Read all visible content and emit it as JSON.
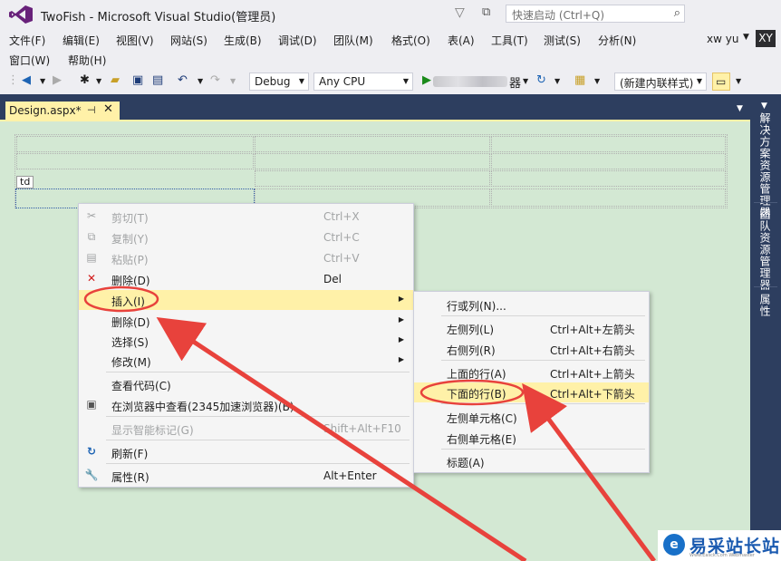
{
  "window": {
    "title": "TwoFish - Microsoft Visual Studio(管理员)",
    "quick_launch_placeholder": "快速启动 (Ctrl+Q)"
  },
  "menubar": {
    "row1": [
      "文件(F)",
      "编辑(E)",
      "视图(V)",
      "网站(S)",
      "生成(B)",
      "调试(D)",
      "团队(M)",
      "格式(O)",
      "表(A)",
      "工具(T)",
      "测试(S)",
      "分析(N)"
    ],
    "row2": [
      "窗口(W)",
      "帮助(H)"
    ],
    "user_name": "xw yu",
    "user_initials": "XY"
  },
  "toolbar": {
    "config": "Debug",
    "platform": "Any CPU",
    "start_suffix": "器",
    "style_target": "(新建内联样式)"
  },
  "document": {
    "tab_label": "Design.aspx*",
    "selected_tag": "td"
  },
  "side_panels": [
    "解决方案资源管理器",
    "团队资源管理器",
    "属性"
  ],
  "context_menu": {
    "items": [
      {
        "label": "剪切(T)",
        "shortcut": "Ctrl+X",
        "icon": "cut-icon",
        "disabled": true
      },
      {
        "label": "复制(Y)",
        "shortcut": "Ctrl+C",
        "icon": "copy-icon",
        "disabled": true
      },
      {
        "label": "粘贴(P)",
        "shortcut": "Ctrl+V",
        "icon": "paste-icon",
        "disabled": true
      },
      {
        "label": "删除(D)",
        "shortcut": "Del",
        "icon": "delete-x-icon",
        "disabled": false
      },
      {
        "label": "插入(I)",
        "shortcut": "",
        "icon": "",
        "submenu": true,
        "highlighted": true
      },
      {
        "label": "删除(D)",
        "shortcut": "",
        "icon": "",
        "submenu": true
      },
      {
        "label": "选择(S)",
        "shortcut": "",
        "icon": "",
        "submenu": true
      },
      {
        "label": "修改(M)",
        "shortcut": "",
        "icon": "",
        "submenu": true
      },
      {
        "label": "查看代码(C)",
        "shortcut": "",
        "icon": ""
      },
      {
        "label": "在浏览器中查看(2345加速浏览器)(B)",
        "shortcut": "",
        "icon": "browser-icon"
      },
      {
        "label": "显示智能标记(G)",
        "shortcut": "Shift+Alt+F10",
        "icon": "",
        "disabled": true
      },
      {
        "label": "刷新(F)",
        "shortcut": "",
        "icon": "refresh-icon"
      },
      {
        "label": "属性(R)",
        "shortcut": "Alt+Enter",
        "icon": "wrench-icon"
      }
    ]
  },
  "insert_submenu": {
    "items": [
      {
        "label": "行或列(N)...",
        "shortcut": ""
      },
      {
        "label": "左侧列(L)",
        "shortcut": "Ctrl+Alt+左箭头"
      },
      {
        "label": "右侧列(R)",
        "shortcut": "Ctrl+Alt+右箭头"
      },
      {
        "label": "上面的行(A)",
        "shortcut": "Ctrl+Alt+上箭头"
      },
      {
        "label": "下面的行(B)",
        "shortcut": "Ctrl+Alt+下箭头",
        "highlighted": true
      },
      {
        "label": "左侧单元格(C)",
        "shortcut": ""
      },
      {
        "label": "右侧单元格(E)",
        "shortcut": ""
      },
      {
        "label": "标题(A)",
        "shortcut": ""
      }
    ]
  },
  "watermark": {
    "text": "易采站长站",
    "sub": "Www.Easck.Com  Webmaster",
    "logo_glyph": "e"
  },
  "colors": {
    "accent_vs": "#68217a",
    "highlight": "#fff1a8",
    "annotation_red": "#e8423c",
    "design_bg": "#d3e8d3",
    "doc_well": "#2d3e5f"
  }
}
